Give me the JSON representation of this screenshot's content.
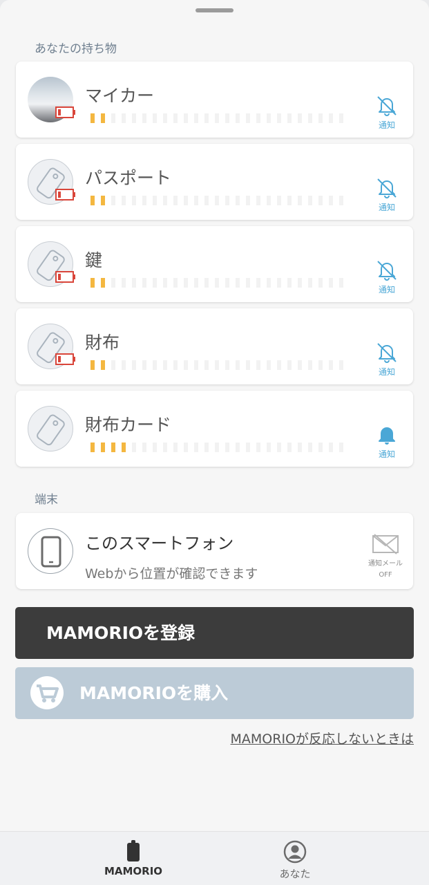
{
  "sections": {
    "belongings": "あなたの持ち物",
    "device": "端末"
  },
  "items": [
    {
      "name": "マイカー",
      "signal_level": 2,
      "signal_max": 25,
      "notify": "off",
      "notify_label": "通知",
      "battery": "low",
      "avatar": "car-photo"
    },
    {
      "name": "パスポート",
      "signal_level": 2,
      "signal_max": 25,
      "notify": "off",
      "notify_label": "通知",
      "battery": "low",
      "avatar": "tag-icon"
    },
    {
      "name": "鍵",
      "signal_level": 2,
      "signal_max": 25,
      "notify": "off",
      "notify_label": "通知",
      "battery": "low",
      "avatar": "tag-icon"
    },
    {
      "name": "財布",
      "signal_level": 2,
      "signal_max": 25,
      "notify": "off",
      "notify_label": "通知",
      "battery": "low",
      "avatar": "tag-icon"
    },
    {
      "name": "財布カード",
      "signal_level": 4,
      "signal_max": 25,
      "notify": "on",
      "notify_label": "通知",
      "battery": null,
      "avatar": "tag-icon"
    }
  ],
  "device": {
    "title": "このスマートフォン",
    "subtitle": "Webから位置が確認できます",
    "mail_label": "通知メール",
    "mail_status": "OFF"
  },
  "buttons": {
    "register": "MAMORIOを登録",
    "buy": "MAMORIOを購入",
    "help_link": "MAMORIOが反応しないときは"
  },
  "tabs": [
    {
      "label": "MAMORIO",
      "active": true
    },
    {
      "label": "あなた",
      "active": false
    }
  ],
  "colors": {
    "signal_on": "#f4b740",
    "notify_blue": "#4aa7d6",
    "battery_red": "#d9453a",
    "register_bg": "#3c3c3c",
    "buy_bg": "#bccbd7"
  }
}
